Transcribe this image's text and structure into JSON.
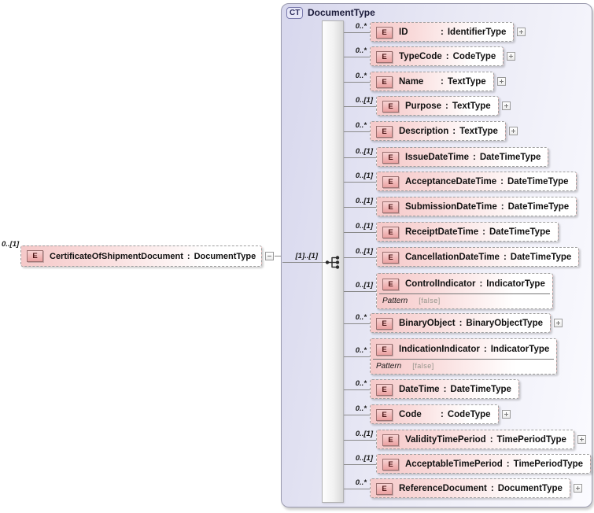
{
  "diagram": {
    "badge_letter": "E",
    "separator": ":",
    "root": {
      "cardinality": "0..[1]",
      "name": "CertificateOfShipmentDocument",
      "type": "DocumentType"
    },
    "connector_cardinality": "[1]..[1]",
    "complex_type": {
      "badge": "CT",
      "title": "DocumentType",
      "elements": [
        {
          "cardinality": "0..*",
          "name": "ID",
          "type": "IdentifierType",
          "expandable": true
        },
        {
          "cardinality": "0..*",
          "name": "TypeCode",
          "type": "CodeType",
          "expandable": true
        },
        {
          "cardinality": "0..*",
          "name": "Name",
          "type": "TextType",
          "expandable": true
        },
        {
          "cardinality": "0..[1]",
          "name": "Purpose",
          "type": "TextType",
          "expandable": true
        },
        {
          "cardinality": "0..*",
          "name": "Description",
          "type": "TextType",
          "expandable": true
        },
        {
          "cardinality": "0..[1]",
          "name": "IssueDateTime",
          "type": "DateTimeType",
          "expandable": false
        },
        {
          "cardinality": "0..[1]",
          "name": "AcceptanceDateTime",
          "type": "DateTimeType",
          "expandable": false
        },
        {
          "cardinality": "0..[1]",
          "name": "SubmissionDateTime",
          "type": "DateTimeType",
          "expandable": false
        },
        {
          "cardinality": "0..[1]",
          "name": "ReceiptDateTime",
          "type": "DateTimeType",
          "expandable": false
        },
        {
          "cardinality": "0..[1]",
          "name": "CancellationDateTime",
          "type": "DateTimeType",
          "expandable": false
        },
        {
          "cardinality": "0..[1]",
          "name": "ControlIndicator",
          "type": "IndicatorType",
          "expandable": false,
          "facet": {
            "label": "Pattern",
            "value": "[false]"
          }
        },
        {
          "cardinality": "0..*",
          "name": "BinaryObject",
          "type": "BinaryObjectType",
          "expandable": true
        },
        {
          "cardinality": "0..*",
          "name": "IndicationIndicator",
          "type": "IndicatorType",
          "expandable": false,
          "facet": {
            "label": "Pattern",
            "value": "[false]"
          }
        },
        {
          "cardinality": "0..*",
          "name": "DateTime",
          "type": "DateTimeType",
          "expandable": false
        },
        {
          "cardinality": "0..*",
          "name": "Code",
          "type": "CodeType",
          "expandable": true
        },
        {
          "cardinality": "0..[1]",
          "name": "ValidityTimePeriod",
          "type": "TimePeriodType",
          "expandable": true
        },
        {
          "cardinality": "0..[1]",
          "name": "AcceptableTimePeriod",
          "type": "TimePeriodType",
          "expandable": true
        },
        {
          "cardinality": "0..*",
          "name": "ReferenceDocument",
          "type": "DocumentType",
          "expandable": true
        }
      ]
    },
    "colors": {
      "element_fill_pink": "#f5c9c9",
      "container_lavender": "#d7d7ed",
      "badge_red_border": "#9a7070",
      "line_gray": "#8a8a8a"
    }
  }
}
